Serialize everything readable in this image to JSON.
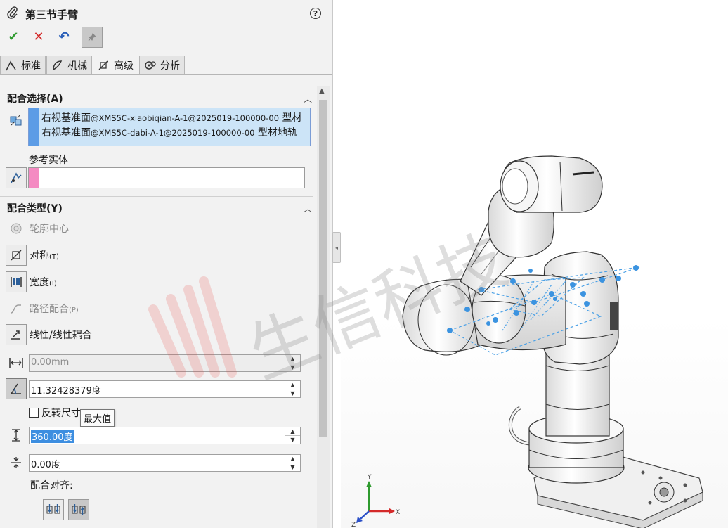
{
  "feature": {
    "title": "第三节手臂",
    "help": "?"
  },
  "actions": {
    "ok": "✔",
    "cancel": "✕",
    "undo": "↶"
  },
  "tabs": [
    {
      "label": "标准",
      "icon": "standard-mates-icon"
    },
    {
      "label": "机械",
      "icon": "mechanical-mates-icon"
    },
    {
      "label": "高级",
      "icon": "advanced-mates-icon"
    },
    {
      "label": "分析",
      "icon": "analysis-icon"
    }
  ],
  "mate_selections": {
    "header": "配合选择(A)",
    "items": [
      {
        "name": "右视基准面",
        "path": "@XMS5C-xiaobiqian-A-1@2025019-100000-00",
        "suffix": " 型材"
      },
      {
        "name": "右视基准面",
        "path": "@XMS5C-dabi-A-1@2025019-100000-00",
        "suffix": " 型材地轨"
      }
    ],
    "ref_label": "参考实体"
  },
  "mate_types": {
    "header": "配合类型(Y)",
    "options": [
      {
        "label": "轮廓中心",
        "key": "",
        "enabled": false
      },
      {
        "label": "对称",
        "key": "(T)",
        "enabled": true
      },
      {
        "label": "宽度",
        "key": "(I)",
        "enabled": true
      },
      {
        "label": "路径配合",
        "key": "(P)",
        "enabled": false
      },
      {
        "label": "线性/线性耦合",
        "key": "",
        "enabled": true
      }
    ]
  },
  "fields": {
    "distance": "0.00mm",
    "angle": "11.32428379度",
    "flip_label": "反转尺寸",
    "tooltip": "最大值",
    "max": "360.00度",
    "min": "0.00度"
  },
  "alignment": {
    "label": "配合对齐:"
  },
  "triad": {
    "x": "X",
    "y": "Y",
    "z": "Z"
  },
  "watermark": {
    "text": "生信科技",
    "color": "#e8433b"
  },
  "colors": {
    "selection_bar": "#5c9ce6",
    "reference_bar": "#f48ac2",
    "ok": "#2e9a2e",
    "cancel": "#d42a2a"
  }
}
